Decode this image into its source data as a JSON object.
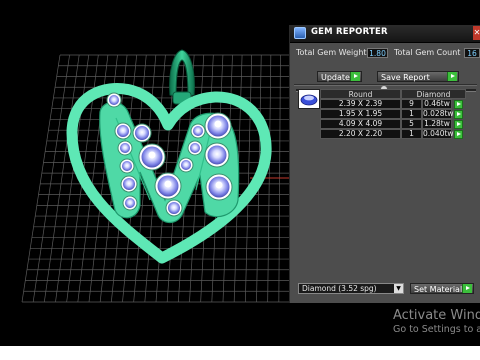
{
  "colors": {
    "jewelry": "#5ee8b5",
    "background": "#000000",
    "grid": "#5a5a5a",
    "panel": "#4d4d4d",
    "accent_green": "#3cbf3c"
  },
  "panel": {
    "title": "GEM REPORTER",
    "close_icon": "close-icon",
    "app_icon": "gem-reporter-app-icon",
    "total_gem_weight_label": "Total Gem Weight",
    "total_gem_weight_value": "1.80",
    "total_gem_count_label": "Total Gem Count",
    "total_gem_count_value": "16",
    "update_label": "Update",
    "save_report_label": "Save Report",
    "slider_position": 0.49,
    "table": {
      "headers": [
        "Round",
        "Diamond"
      ],
      "rows": [
        {
          "size": "2.39 X 2.39",
          "count": "9",
          "weight": "0.46tw"
        },
        {
          "size": "1.95 X 1.95",
          "count": "1",
          "weight": "0.028tw"
        },
        {
          "size": "4.09 X 4.09",
          "count": "5",
          "weight": "1.28tw"
        },
        {
          "size": "2.20 X 2.20",
          "count": "1",
          "weight": "0.040tw"
        }
      ]
    },
    "material_select": "Diamond   (3.52 spg)",
    "set_material_label": "Set Material"
  },
  "watermark": {
    "line1": "Activate Windo",
    "line2": "Go to Settings to acti"
  }
}
